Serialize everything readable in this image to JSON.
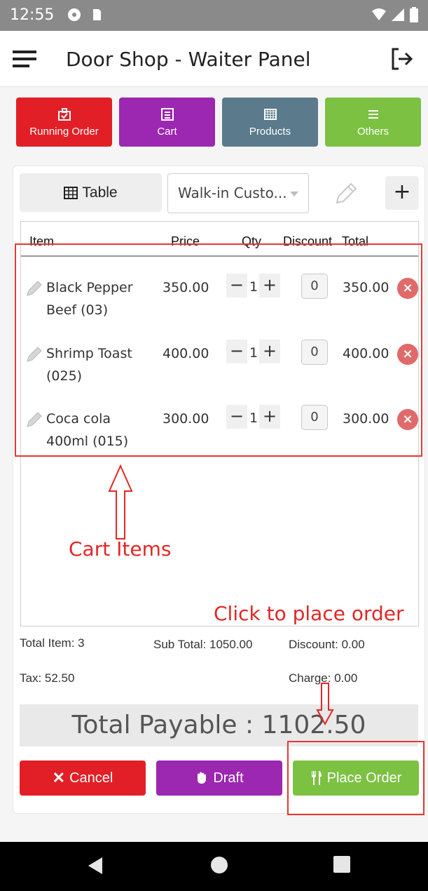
{
  "status_bar": {
    "time": "12:55"
  },
  "app_bar": {
    "title": "Door Shop - Waiter Panel"
  },
  "menu": [
    {
      "label": "Running Order",
      "color": "#e21f26",
      "icon": "running-order-icon"
    },
    {
      "label": "Cart",
      "color": "#9c27b0",
      "icon": "cart-icon"
    },
    {
      "label": "Products",
      "color": "#5b7a8c",
      "icon": "products-grid-icon"
    },
    {
      "label": "Others",
      "color": "#7cc142",
      "icon": "others-menu-icon"
    }
  ],
  "order": {
    "table_label": "Table",
    "customer": "Walk-in Custo..."
  },
  "table_headers": {
    "item": "Item",
    "price": "Price",
    "qty": "Qty",
    "discount": "Discount",
    "total": "Total"
  },
  "items": [
    {
      "name": "Black Pepper Beef (03)",
      "price": "350.00",
      "qty": "1",
      "discount": "0",
      "total": "350.00"
    },
    {
      "name": "Shrimp Toast (025)",
      "price": "400.00",
      "qty": "1",
      "discount": "0",
      "total": "400.00"
    },
    {
      "name": "Coca cola 400ml (015)",
      "price": "300.00",
      "qty": "1",
      "discount": "0",
      "total": "300.00"
    }
  ],
  "summary": {
    "total_item": "Total Item: 3",
    "sub_total": "Sub Total: 1050.00",
    "discount": "Discount: 0.00",
    "tax": "Tax: 52.50",
    "charge": "Charge: 0.00",
    "total_payable": "Total Payable : 1102.50"
  },
  "actions": {
    "cancel": "Cancel",
    "draft": "Draft",
    "place_order": "Place Order"
  },
  "annotations": {
    "cart_items": "Cart Items",
    "click_to_place": "Click to place order",
    "color": "#e32626"
  },
  "colors": {
    "cancel": "#e21f26",
    "draft": "#9c27b0",
    "place_order": "#7cc142"
  }
}
